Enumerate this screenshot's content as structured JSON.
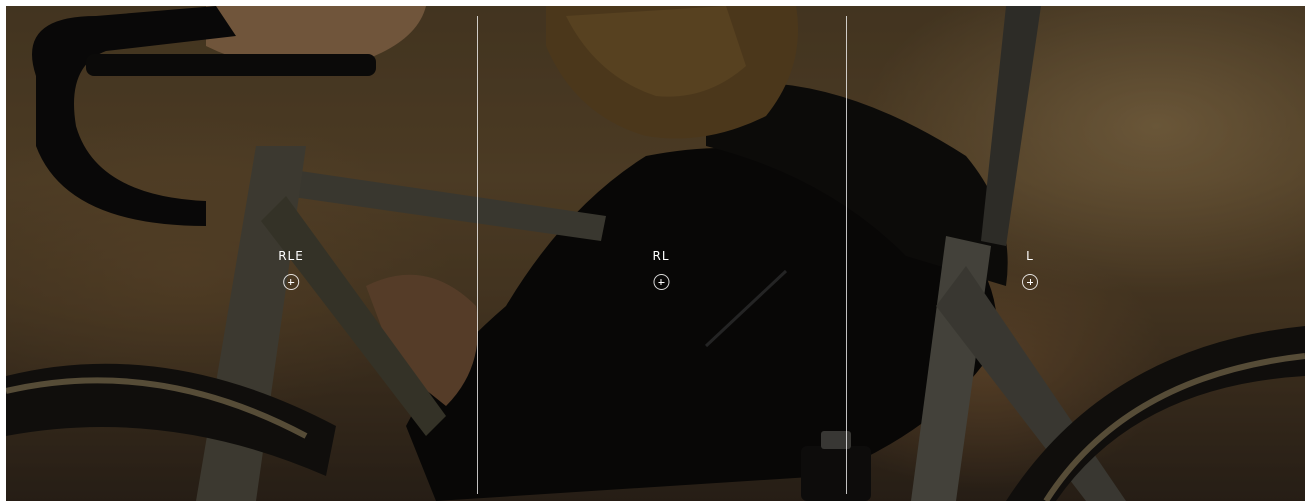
{
  "hero": {
    "panels": [
      {
        "label": "RLE"
      },
      {
        "label": "RL"
      },
      {
        "label": "L"
      }
    ],
    "expand_icon": "plus-circle-icon",
    "colors": {
      "label_text": "#ffffff",
      "divider": "#ffffff"
    }
  }
}
